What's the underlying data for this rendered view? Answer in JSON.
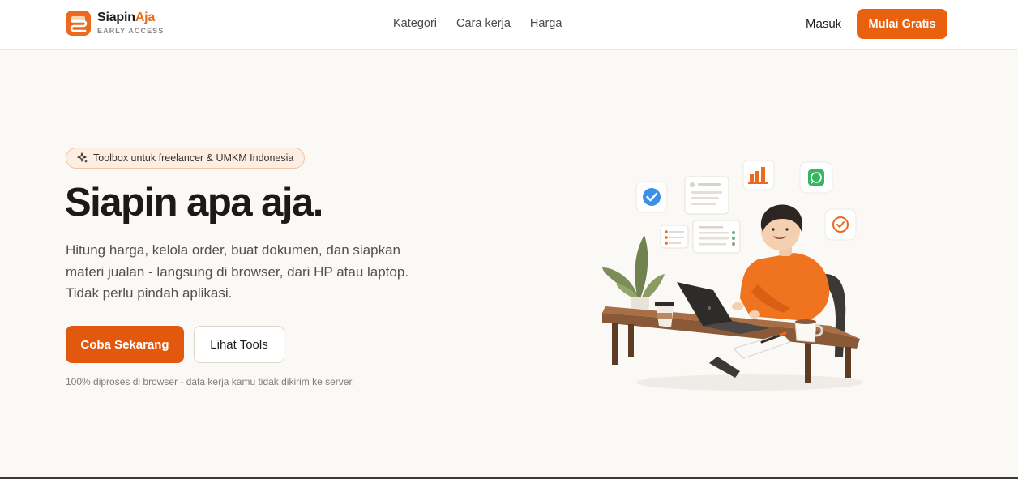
{
  "brand": {
    "name_main": "Siapin",
    "name_accent": "Aja",
    "tag": "EARLY ACCESS"
  },
  "nav": {
    "items": [
      {
        "label": "Kategori"
      },
      {
        "label": "Cara kerja"
      },
      {
        "label": "Harga"
      }
    ],
    "login_label": "Masuk",
    "cta_label": "Mulai Gratis"
  },
  "hero": {
    "badge_icon": "sparkle-icon",
    "badge_text": "Toolbox untuk freelancer & UMKM Indonesia",
    "title": "Siapin apa aja.",
    "description": "Hitung harga, kelola order, buat dokumen, dan siapkan materi jualan - langsung di browser, dari HP atau laptop. Tidak perlu pindah aplikasi.",
    "primary_cta": "Coba Sekarang",
    "secondary_cta": "Lihat Tools",
    "footnote": "100% diproses di browser - data kerja kamu tidak dikirim ke server."
  },
  "colors": {
    "accent": "#e9600f",
    "background": "#fbf9f6",
    "badge_bg": "#fdeee4"
  },
  "illustration": {
    "icons": [
      "check-icon",
      "document-icon",
      "bar-chart-icon",
      "whatsapp-icon",
      "task-check-icon",
      "list-icon"
    ]
  }
}
